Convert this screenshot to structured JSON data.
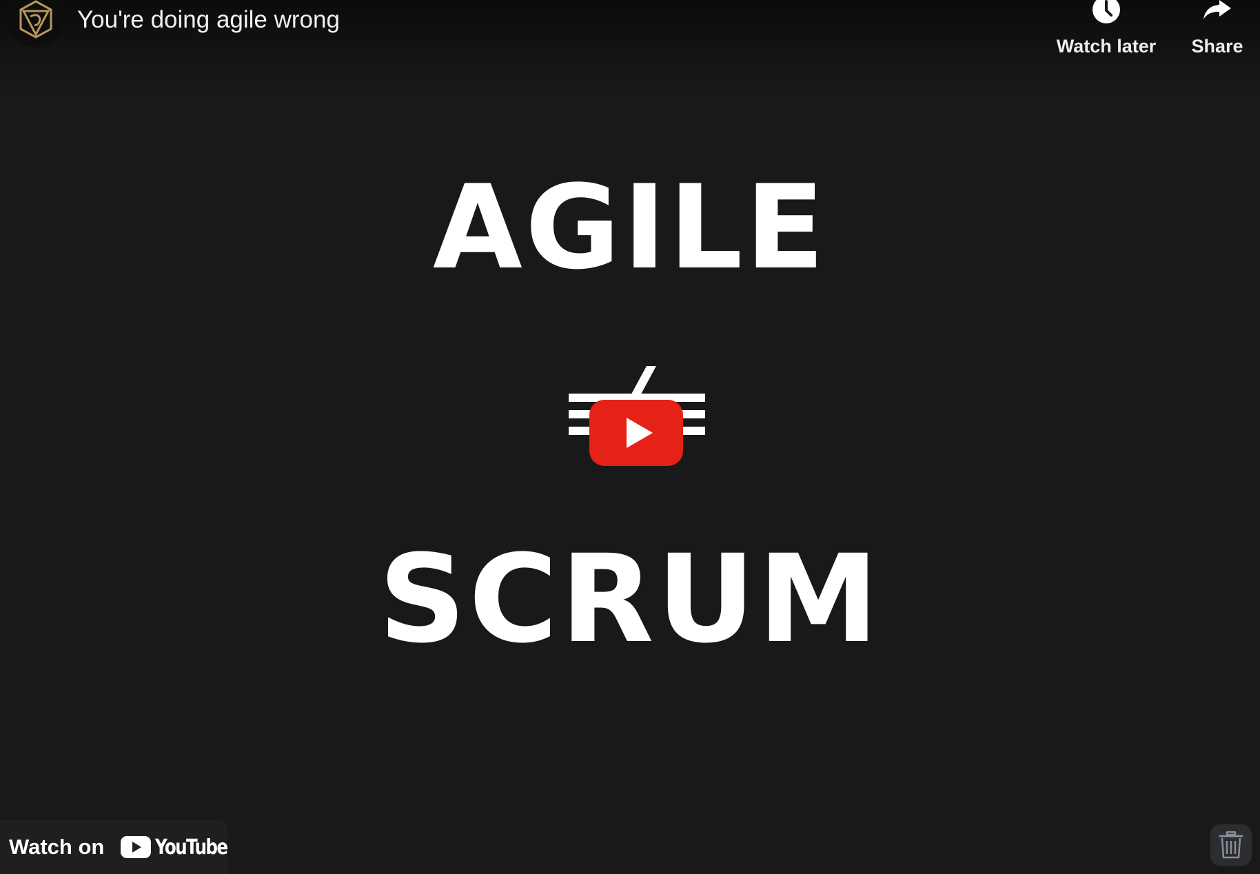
{
  "player": {
    "title": "You're doing agile wrong",
    "actions": {
      "watch_later": "Watch later",
      "share": "Share"
    }
  },
  "slide": {
    "top_word": "AGILE",
    "bottom_word": "SCRUM"
  },
  "footer": {
    "watch_on": "Watch on",
    "youtube_logo": "YouTube"
  },
  "icons": {
    "channel": "channel-logo-icon",
    "watch_later": "clock-icon",
    "share": "share-arrow-icon",
    "play": "play-icon",
    "delete": "trash-icon"
  },
  "colors": {
    "background": "#19191a",
    "play_red": "#e62117",
    "channel_gold": "#b8975a"
  }
}
